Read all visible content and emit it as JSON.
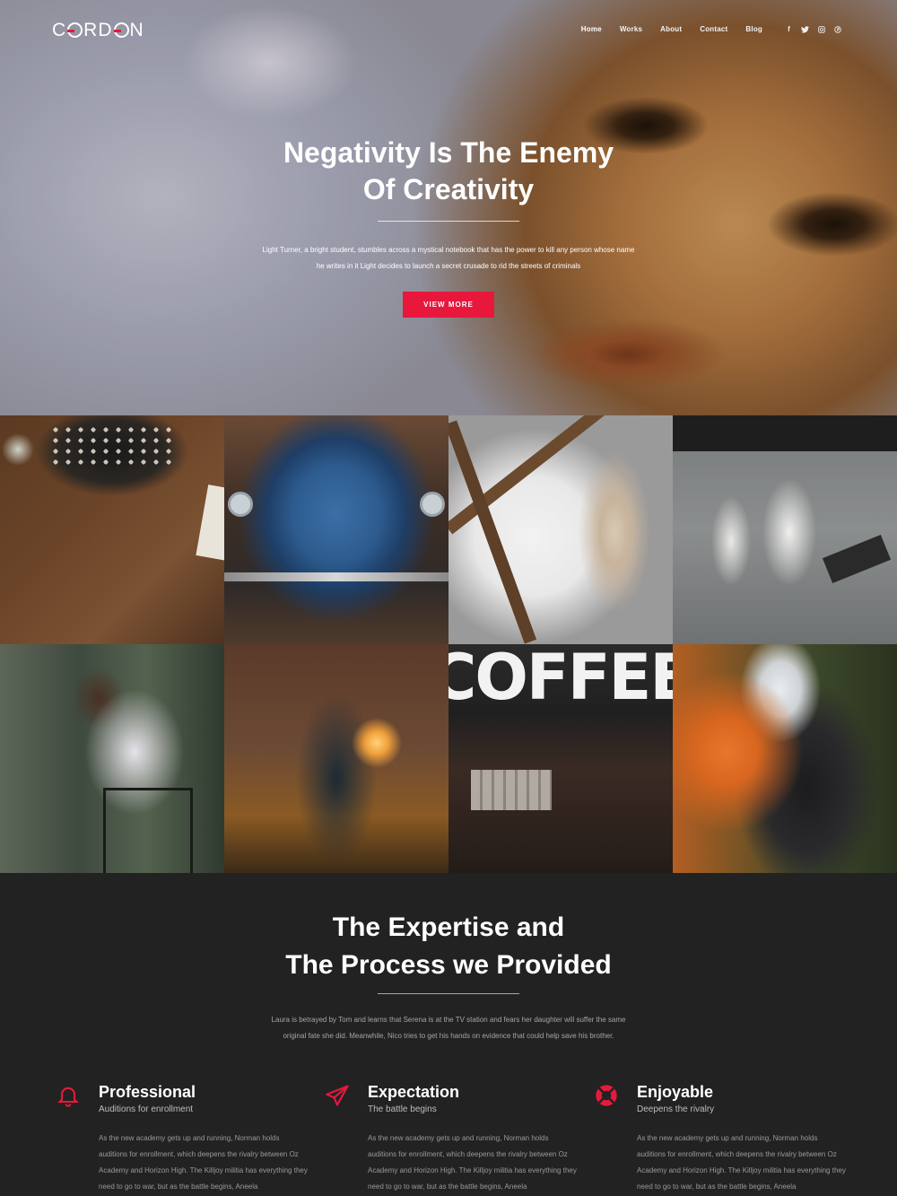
{
  "brand": {
    "logo_pre": "C",
    "logo_mid": "R",
    "logo_post": "D",
    "logo_end": "N",
    "accent": "#e8183d"
  },
  "nav": {
    "items": [
      {
        "label": "Home",
        "active": true
      },
      {
        "label": "Works"
      },
      {
        "label": "About"
      },
      {
        "label": "Contact"
      },
      {
        "label": "Blog"
      }
    ]
  },
  "socials": [
    {
      "icon": "facebook-icon",
      "glyph": "f"
    },
    {
      "icon": "twitter-icon",
      "glyph": "t"
    },
    {
      "icon": "instagram-icon",
      "glyph": "◎"
    },
    {
      "icon": "pinterest-icon",
      "glyph": "℗"
    }
  ],
  "hero": {
    "title_line1": "Negativity Is The Enemy",
    "title_line2": "Of Creativity",
    "description": "Light Turner, a bright student, stumbles across a mystical notebook that has the power to kill any person whose name he writes in it Light decides to launch a secret crusade to rid the streets of criminals",
    "cta_label": "VIEW MORE"
  },
  "gallery": {
    "word": "COFFEE"
  },
  "expertise": {
    "title_line1": "The Expertise and",
    "title_line2": "The Process we Provided",
    "description": "Laura is betrayed by Tom and learns that Serena is at the TV station and fears her daughter will suffer the same original fate she did. Meanwhile, Nico tries to get his hands on evidence that could help save his brother.",
    "features": [
      {
        "icon": "bell-icon",
        "title": "Professional",
        "subtitle": "Auditions for enrollment",
        "body": "As the new academy gets up and running, Norman holds auditions for enrollment, which deepens the rivalry between Oz Academy and Horizon High. The Killjoy militia has everything they need to go to war, but as the battle begins, Aneela"
      },
      {
        "icon": "paper-plane-icon",
        "title": "Expectation",
        "subtitle": "The battle begins",
        "body": "As the new academy gets up and running, Norman holds auditions for enrollment, which deepens the rivalry between Oz Academy and Horizon High. The Killjoy militia has everything they need to go to war, but as the battle begins, Aneela"
      },
      {
        "icon": "lifebuoy-icon",
        "title": "Enjoyable",
        "subtitle": "Deepens the rivalry",
        "body": "As the new academy gets up and running, Norman holds auditions for enrollment, which deepens the rivalry between Oz Academy and Horizon High. The Killjoy militia has everything they need to go to war, but as the battle begins, Aneela"
      }
    ]
  }
}
